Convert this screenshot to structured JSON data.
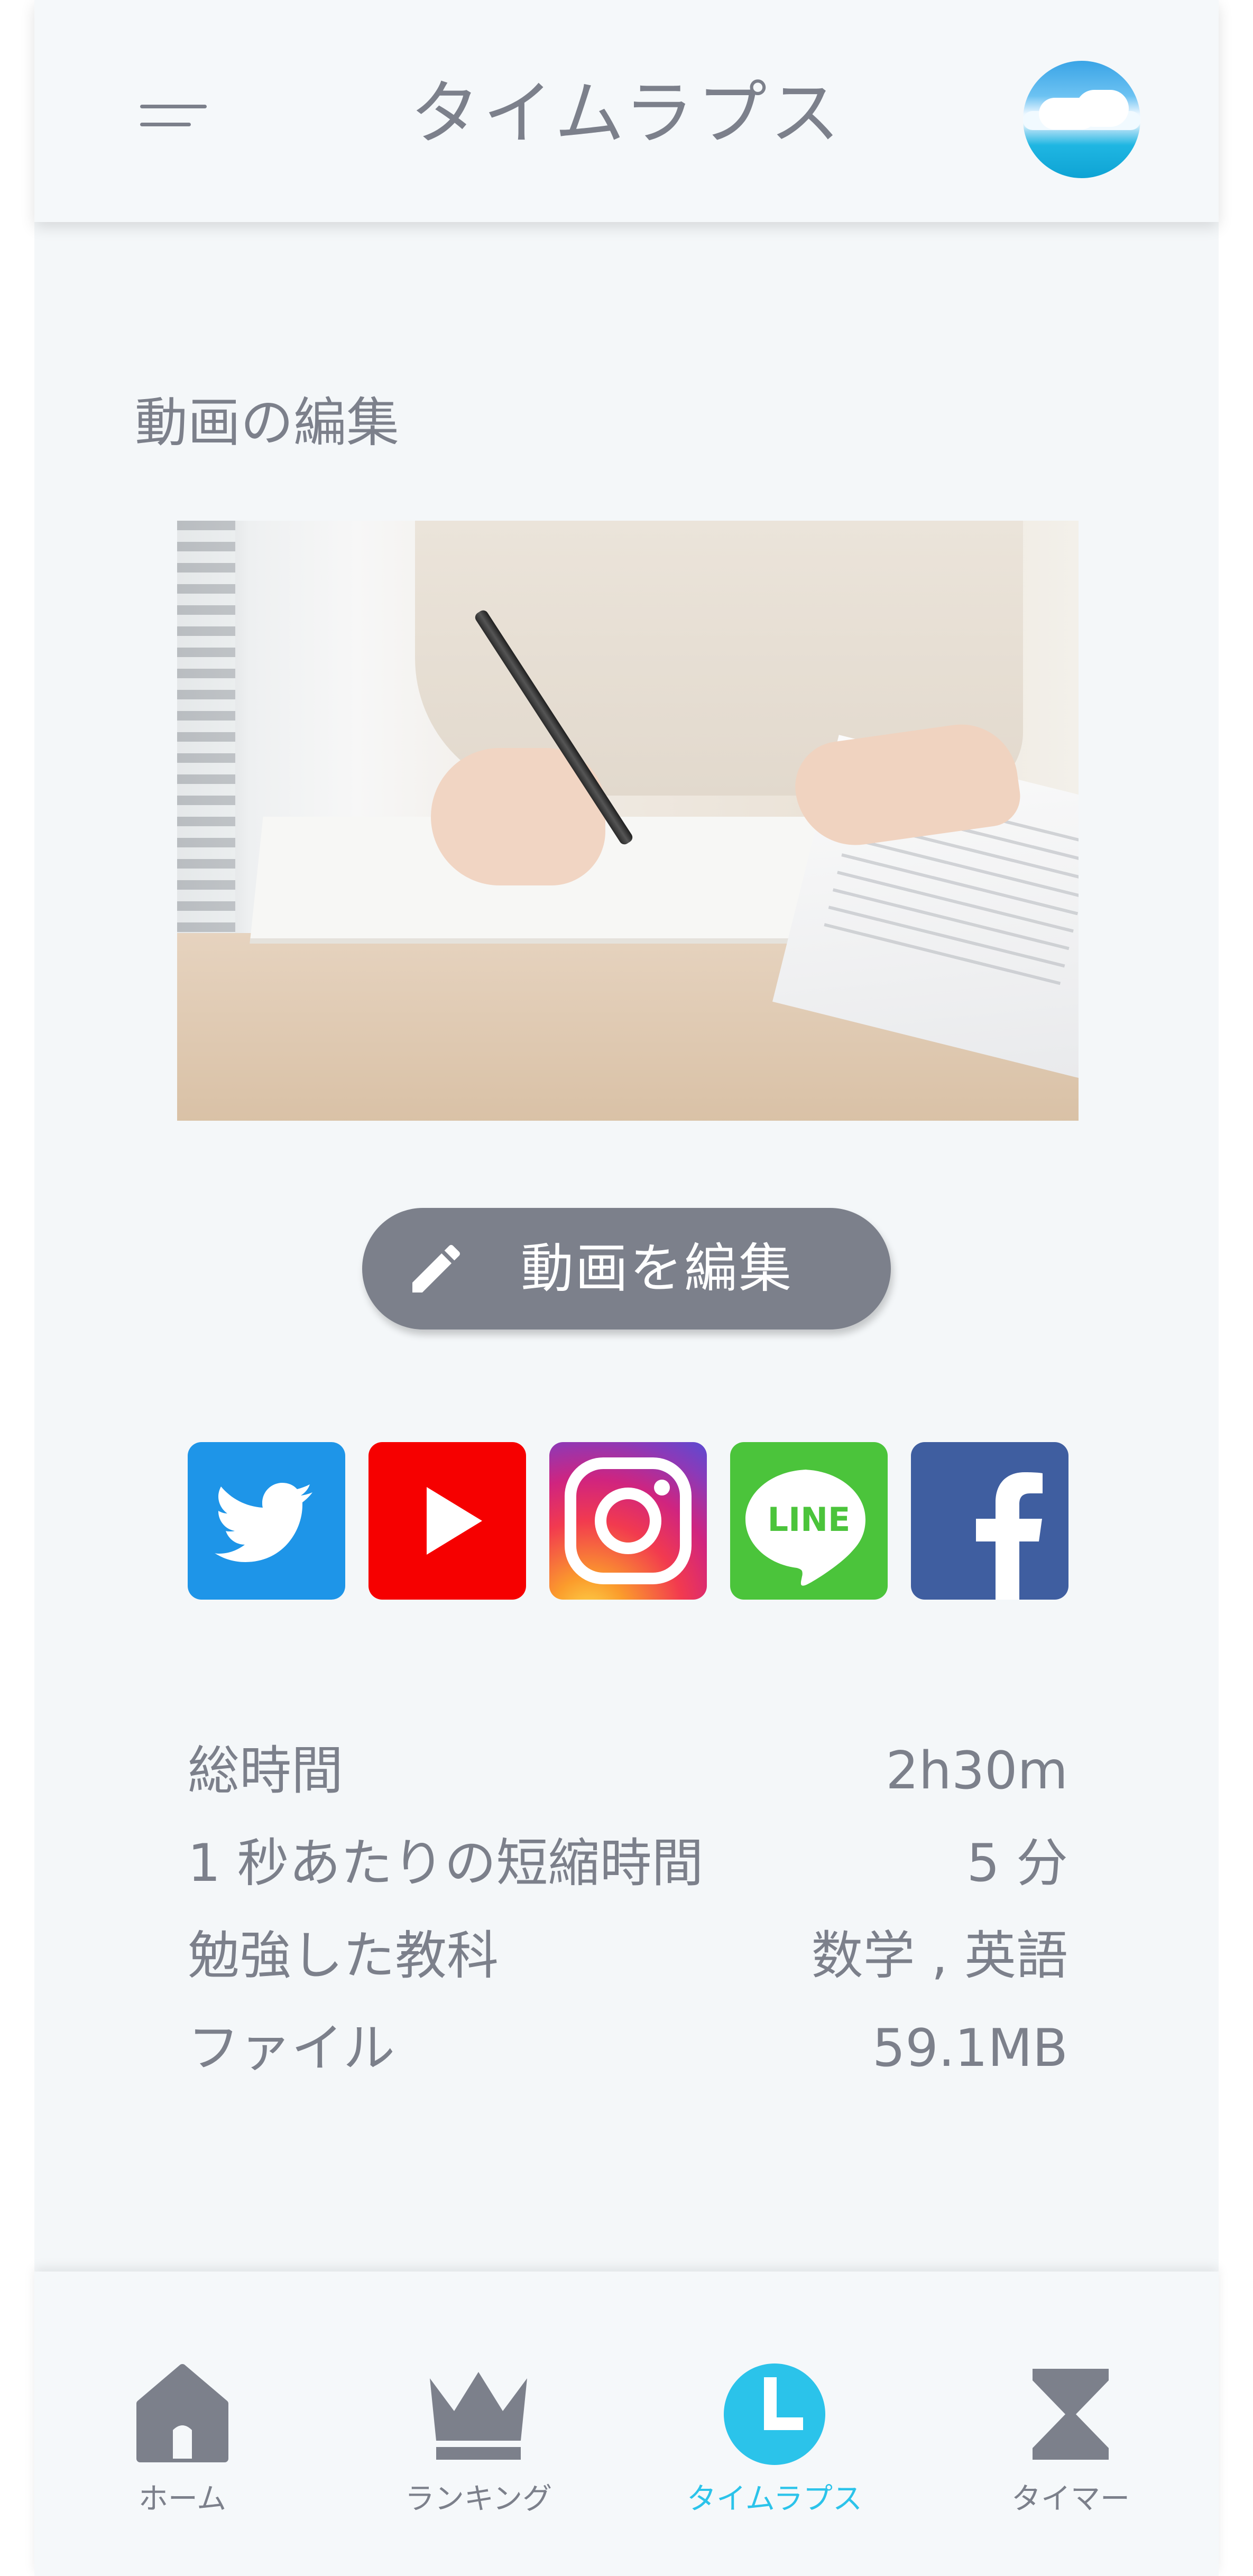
{
  "header": {
    "title": "タイムラプス",
    "menu_icon": "menu-icon",
    "avatar_icon": "avatar"
  },
  "main": {
    "section_title": "動画の編集",
    "edit_button_label": "動画を編集",
    "edit_icon": "pencil-icon",
    "social": [
      {
        "name": "twitter",
        "color": "#1e95e8"
      },
      {
        "name": "youtube",
        "color": "#f60000"
      },
      {
        "name": "instagram",
        "color": "#d0247f"
      },
      {
        "name": "line",
        "color": "#4bc43b",
        "label": "LINE"
      },
      {
        "name": "facebook",
        "color": "#3f5ea0"
      }
    ],
    "details": [
      {
        "label": "総時間",
        "value": "2h30m"
      },
      {
        "label": "1 秒あたりの短縮時間",
        "value": "5 分"
      },
      {
        "label": "勉強した教科",
        "value": "数学 , 英語"
      },
      {
        "label": "ファイル",
        "value": "59.1MB"
      }
    ]
  },
  "nav": {
    "items": [
      {
        "label": "ホーム",
        "icon": "home-icon"
      },
      {
        "label": "ランキング",
        "icon": "crown-icon"
      },
      {
        "label": "タイムラプス",
        "icon": "clock-icon",
        "active": true
      },
      {
        "label": "タイマー",
        "icon": "hourglass-icon"
      }
    ],
    "active_color": "#2bc3ea",
    "inactive_color": "#7c808b"
  }
}
